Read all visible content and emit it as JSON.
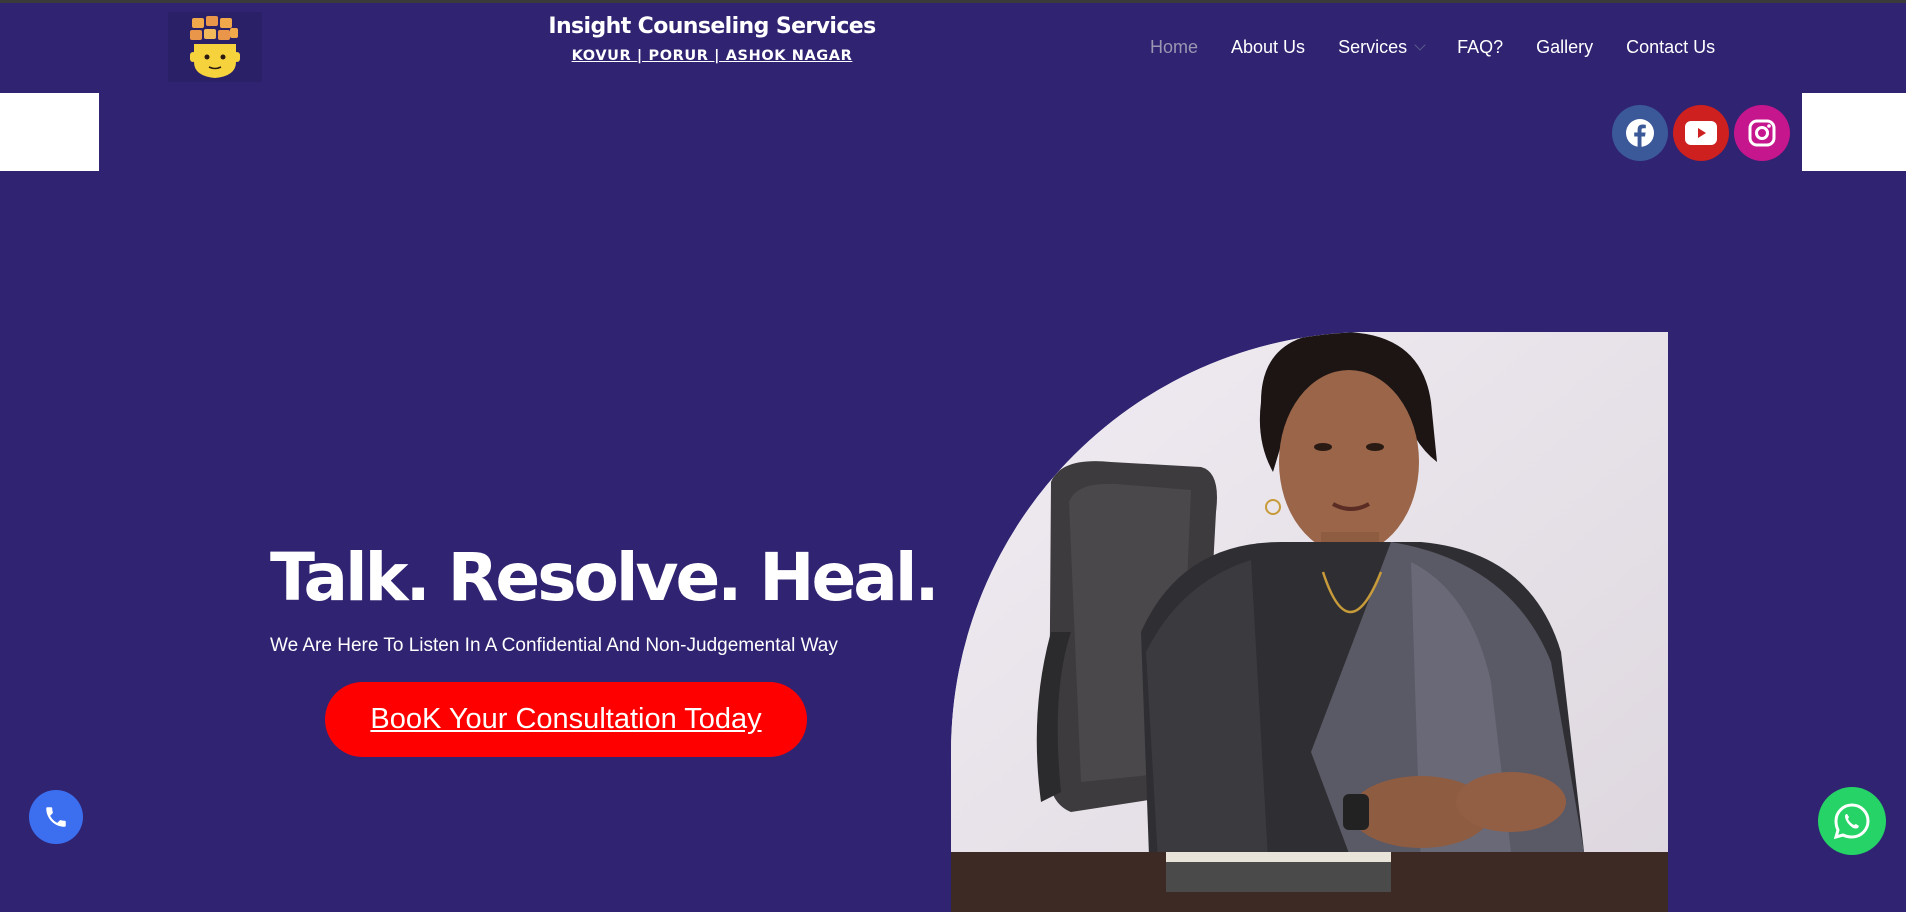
{
  "header": {
    "logo_icon": "puzzle-head-logo",
    "title": "Insight Counseling Services",
    "subtitle": "KOVUR | PORUR | ASHOK NAGAR"
  },
  "nav": {
    "items": [
      {
        "label": "Home",
        "active": true
      },
      {
        "label": "About Us"
      },
      {
        "label": "Services",
        "has_dropdown": true
      },
      {
        "label": "FAQ?"
      },
      {
        "label": "Gallery"
      },
      {
        "label": "Contact Us"
      }
    ]
  },
  "social": [
    {
      "icon": "facebook-icon",
      "color": "#3b5998"
    },
    {
      "icon": "youtube-icon",
      "color": "#cd201f"
    },
    {
      "icon": "instagram-icon",
      "color": "#c6168d"
    }
  ],
  "hero": {
    "title": "Talk. Resolve. Heal.",
    "subtitle": "We Are Here To Listen In A Confidential And Non-Judgemental Way",
    "cta_label": "BooK Your Consultation Today",
    "photo_alt": "counselor-portrait-photo"
  },
  "floating": {
    "call_icon": "phone-icon",
    "whatsapp_icon": "whatsapp-icon"
  },
  "colors": {
    "background": "#2f2372",
    "cta": "#ff0000",
    "nav_active": "#9a97b3",
    "call_button": "#3b6ff0",
    "whatsapp": "#25d366"
  }
}
